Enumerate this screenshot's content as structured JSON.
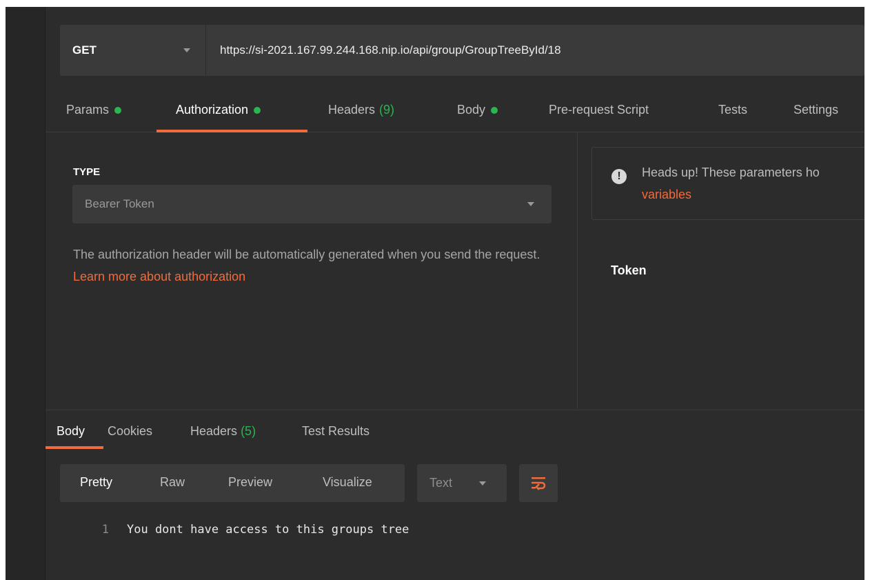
{
  "request": {
    "method": "GET",
    "url": "https://si-2021.167.99.244.168.nip.io/api/group/GroupTreeById/18"
  },
  "request_tabs": [
    {
      "label": "Params",
      "dot": true
    },
    {
      "label": "Authorization",
      "dot": true,
      "active": true
    },
    {
      "label": "Headers",
      "count": "(9)"
    },
    {
      "label": "Body",
      "dot": true
    },
    {
      "label": "Pre-request Script"
    },
    {
      "label": "Tests"
    },
    {
      "label": "Settings"
    }
  ],
  "auth": {
    "type_label": "TYPE",
    "type_value": "Bearer Token",
    "description": "The authorization header will be automatically generated when you send the request. ",
    "learn_more": "Learn more about authorization",
    "notice_text": "Heads up! These parameters ho",
    "notice_link": "variables",
    "token_label": "Token"
  },
  "response_tabs": [
    {
      "label": "Body",
      "active": true
    },
    {
      "label": "Cookies"
    },
    {
      "label": "Headers",
      "count": "(5)"
    },
    {
      "label": "Test Results"
    }
  ],
  "response_view": {
    "modes": [
      "Pretty",
      "Raw",
      "Preview",
      "Visualize"
    ],
    "active_mode": "Pretty",
    "format": "Text"
  },
  "response_body": [
    {
      "line": "1",
      "text": "You dont have access to this groups tree"
    }
  ],
  "colors": {
    "accent": "#f26b3a",
    "success": "#2ab64f",
    "background": "#2c2c2c"
  }
}
